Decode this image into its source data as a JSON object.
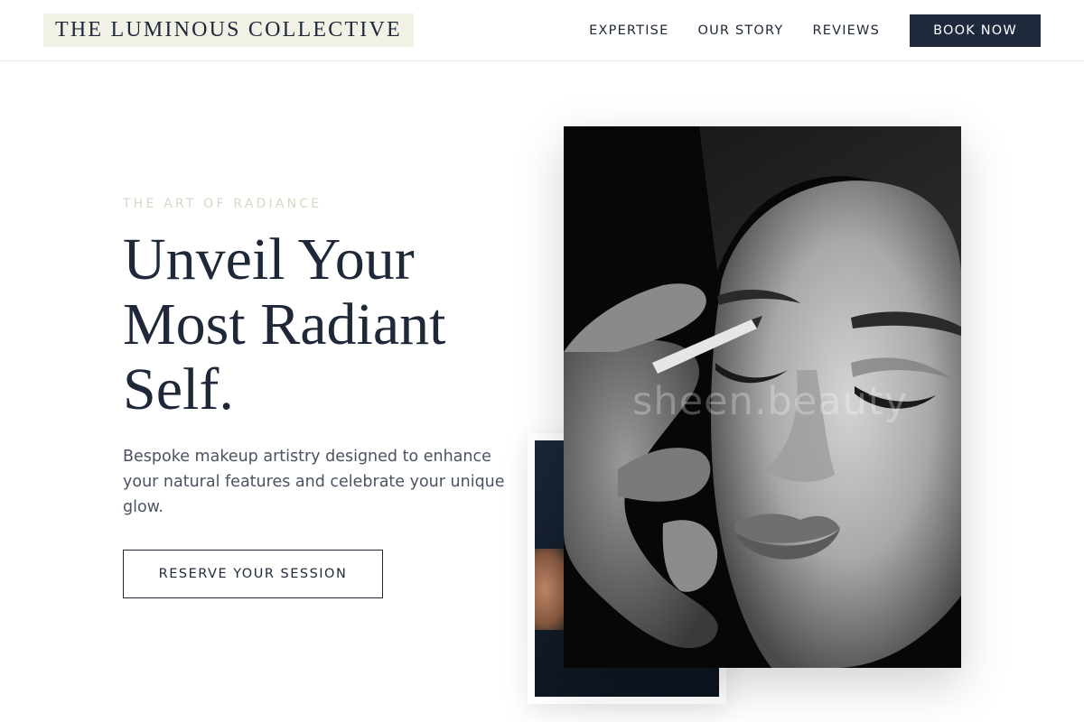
{
  "header": {
    "logo": "THE LUMINOUS COLLECTIVE",
    "nav": [
      "EXPERTISE",
      "OUR STORY",
      "REVIEWS"
    ],
    "book_label": "BOOK NOW"
  },
  "hero": {
    "eyebrow": "THE ART OF RADIANCE",
    "headline": "Unveil Your Most Radiant Self.",
    "subtext": "Bespoke makeup artistry designed to enhance your natural features and celebrate your unique glow.",
    "cta_label": "RESERVE YOUR SESSION"
  },
  "images": {
    "watermark": "sheen.beauty"
  },
  "colors": {
    "navy": "#1e2a3c",
    "logo_bg": "#f2f1e6",
    "eyebrow": "#d9d7c3"
  }
}
